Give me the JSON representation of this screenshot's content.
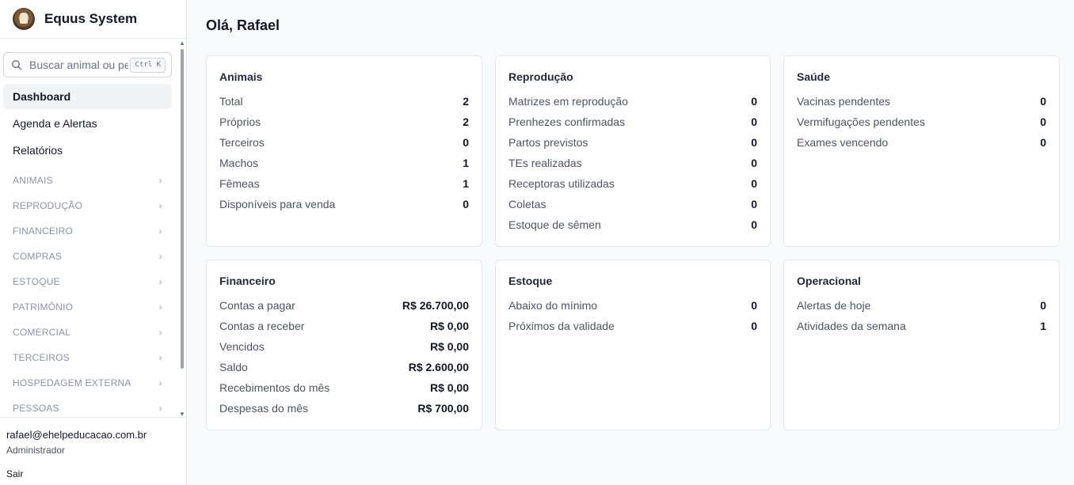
{
  "brand": {
    "name": "Equus System"
  },
  "search": {
    "placeholder": "Buscar animal ou pessoa",
    "shortcut": "Ctrl K"
  },
  "nav": [
    {
      "label": "Dashboard",
      "active": true
    },
    {
      "label": "Agenda e Alertas"
    },
    {
      "label": "Relatórios"
    }
  ],
  "sections": [
    "ANIMAIS",
    "REPRODUÇÃO",
    "FINANCEIRO",
    "COMPRAS",
    "ESTOQUE",
    "PATRIMÔNIO",
    "COMERCIAL",
    "TERCEIROS",
    "HOSPEDAGEM EXTERNA",
    "PESSOAS"
  ],
  "user": {
    "email": "rafael@ehelpeducacao.com.br",
    "role": "Administrador",
    "logout": "Sair"
  },
  "greeting": "Olá, Rafael",
  "cards": {
    "animais": {
      "title": "Animais",
      "rows": [
        {
          "label": "Total",
          "value": "2"
        },
        {
          "label": "Próprios",
          "value": "2"
        },
        {
          "label": "Terceiros",
          "value": "0"
        },
        {
          "label": "Machos",
          "value": "1"
        },
        {
          "label": "Fêmeas",
          "value": "1"
        },
        {
          "label": "Disponíveis para venda",
          "value": "0"
        }
      ]
    },
    "reproducao": {
      "title": "Reprodução",
      "rows": [
        {
          "label": "Matrizes em reprodução",
          "value": "0"
        },
        {
          "label": "Prenhezes confirmadas",
          "value": "0"
        },
        {
          "label": "Partos previstos",
          "value": "0"
        },
        {
          "label": "TEs realizadas",
          "value": "0"
        },
        {
          "label": "Receptoras utilizadas",
          "value": "0"
        },
        {
          "label": "Coletas",
          "value": "0"
        },
        {
          "label": "Estoque de sêmen",
          "value": "0"
        }
      ]
    },
    "saude": {
      "title": "Saúde",
      "rows": [
        {
          "label": "Vacinas pendentes",
          "value": "0"
        },
        {
          "label": "Vermifugações pendentes",
          "value": "0"
        },
        {
          "label": "Exames vencendo",
          "value": "0"
        }
      ]
    },
    "financeiro": {
      "title": "Financeiro",
      "rows": [
        {
          "label": "Contas a pagar",
          "value": "R$ 26.700,00"
        },
        {
          "label": "Contas a receber",
          "value": "R$ 0,00"
        },
        {
          "label": "Vencidos",
          "value": "R$ 0,00"
        },
        {
          "label": "Saldo",
          "value": "R$ 2.600,00"
        },
        {
          "label": "Recebimentos do mês",
          "value": "R$ 0,00"
        },
        {
          "label": "Despesas do mês",
          "value": "R$ 700,00"
        }
      ]
    },
    "estoque": {
      "title": "Estoque",
      "rows": [
        {
          "label": "Abaixo do mínimo",
          "value": "0"
        },
        {
          "label": "Próximos da validade",
          "value": "0"
        }
      ]
    },
    "operacional": {
      "title": "Operacional",
      "rows": [
        {
          "label": "Alertas de hoje",
          "value": "0"
        },
        {
          "label": "Atividades da semana",
          "value": "1"
        }
      ]
    }
  }
}
